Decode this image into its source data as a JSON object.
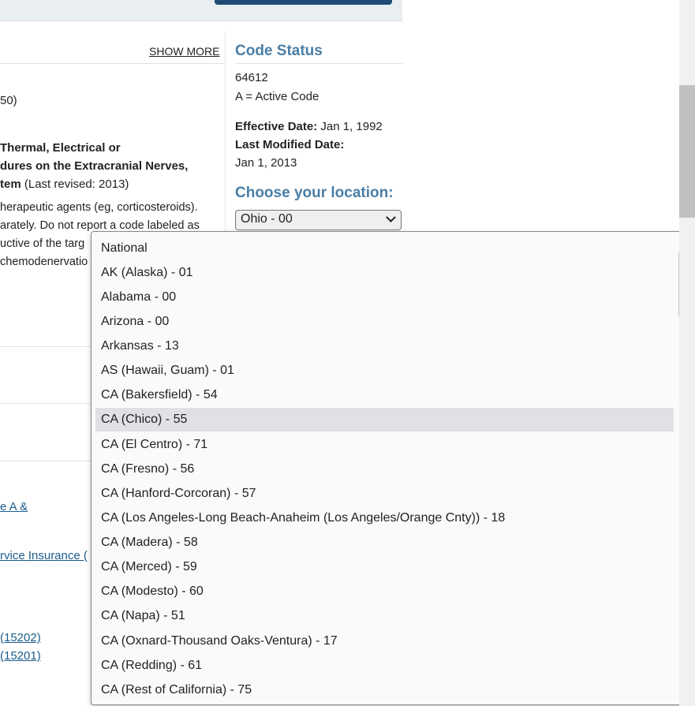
{
  "page": {
    "show_more": "SHOW MORE",
    "left": {
      "paren_fragment": "50)",
      "title_line1": "Thermal, Electrical or",
      "title_line2": "dures on the Extracranial Nerves,",
      "title_line3_bold": "tem",
      "title_line3_rest": " (Last revised: 2013)",
      "desc_line1": "herapeutic agents (eg, corticosteroids).",
      "desc_line2": "arately. Do not report a code labeled as",
      "desc_line3": "uctive of the targ",
      "desc_line4": "chemodenervatio",
      "link1": "e A &",
      "link2": "rvice Insurance (",
      "link3": " (15202)",
      "link4": " (15201)"
    },
    "code_status": {
      "heading": "Code Status",
      "code": "64612",
      "status": "A = Active Code",
      "effective_label": "Effective Date:",
      "effective_value": " Jan 1, 1992",
      "modified_label": "Last Modified Date:",
      "modified_value": "Jan 1, 2013"
    },
    "location": {
      "heading": "Choose your location:",
      "selected": "Ohio - 00",
      "options": [
        "National",
        "AK (Alaska) - 01",
        "Alabama - 00",
        "Arizona - 00",
        "Arkansas - 13",
        "AS (Hawaii, Guam) - 01",
        "CA (Bakersfield) - 54",
        "CA (Chico) - 55",
        "CA (El Centro) - 71",
        "CA (Fresno) - 56",
        "CA (Hanford-Corcoran) - 57",
        "CA (Los Angeles-Long Beach-Anaheim (Los Angeles/Orange Cnty)) - 18",
        "CA (Madera) - 58",
        "CA (Merced) - 59",
        "CA (Modesto) - 60",
        "CA (Napa) - 51",
        "CA (Oxnard-Thousand Oaks-Ventura) - 17",
        "CA (Redding) - 61",
        "CA (Rest of California) - 75"
      ],
      "highlighted_option": "CA (Chico) - 55"
    }
  }
}
